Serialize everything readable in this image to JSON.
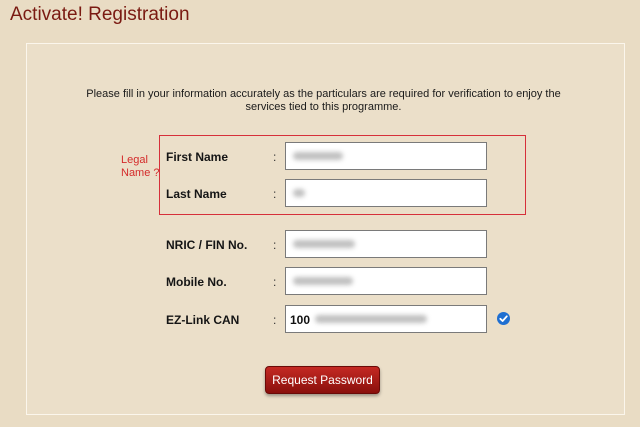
{
  "page": {
    "title": "Activate! Registration"
  },
  "form": {
    "instructions": "Please fill in your information accurately as the particulars are required for verification to enjoy the services tied to this programme.",
    "legal_name_label": "Legal Name ?",
    "colon": ":",
    "fields": {
      "first_name": {
        "label": "First Name",
        "value": ""
      },
      "last_name": {
        "label": "Last Name",
        "value": ""
      },
      "nric": {
        "label": "NRIC / FIN No.",
        "value": ""
      },
      "mobile": {
        "label": "Mobile No.",
        "value": ""
      },
      "ezlink": {
        "label": "EZ-Link CAN",
        "visible_prefix": "100"
      }
    },
    "submit_label": "Request Password",
    "verified_icon": "check-circle-icon"
  },
  "colors": {
    "background": "#e9dcc4",
    "title": "#7a1a12",
    "highlight_border": "#d6303a",
    "button": "#a81c17",
    "check": "#1f6fd1"
  }
}
